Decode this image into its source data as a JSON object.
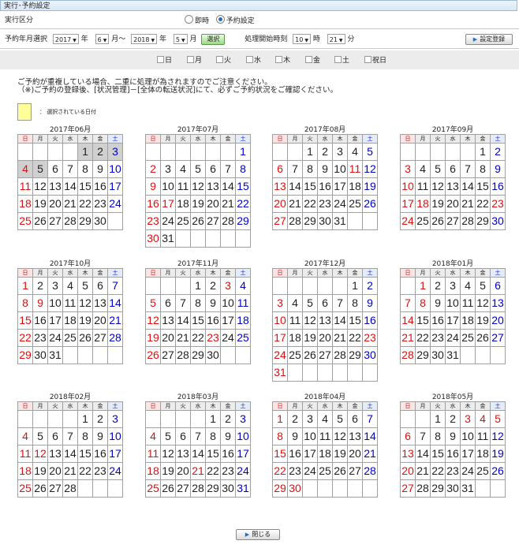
{
  "header": {
    "title": "実行･予約設定"
  },
  "exec": {
    "label": "実行区分",
    "options": [
      {
        "label": "即時",
        "selected": false
      },
      {
        "label": "予約設定",
        "selected": true
      }
    ]
  },
  "schedule": {
    "label": "予約年月選択",
    "from_year": "2017",
    "year_label1": "年",
    "from_month": "6",
    "month_label1": "月～",
    "to_year": "2018",
    "year_label2": "年",
    "to_month": "5",
    "month_label2": "月",
    "select_button": "選択",
    "time_label": "処理開始時刻",
    "hour": "10",
    "hour_label": "時",
    "minute": "21",
    "minute_label": "分",
    "settings_button": "設定登録"
  },
  "weekdays_filter": [
    "日",
    "月",
    "火",
    "水",
    "木",
    "金",
    "土",
    "祝日"
  ],
  "notice": {
    "line1": "ご予約が重複している場合、二重に処理が為されますのでご注意ください。",
    "line2": "（※)ご予約の登録後、[状況管理]－[全体の転送状況]にて、必ずご予約状況をご確認ください。"
  },
  "legend": {
    "text": "：  選択されている日付",
    "color": "#ffff99"
  },
  "weekday_headers": [
    "日",
    "月",
    "火",
    "水",
    "木",
    "金",
    "土"
  ],
  "calendars": [
    {
      "title": "2017年06月",
      "first_dow": 4,
      "days": 30,
      "red": [],
      "gray": [
        1,
        2,
        3,
        4,
        5
      ]
    },
    {
      "title": "2017年07月",
      "first_dow": 6,
      "days": 31,
      "red": [
        17
      ],
      "gray": []
    },
    {
      "title": "2017年08月",
      "first_dow": 2,
      "days": 31,
      "red": [
        11
      ],
      "gray": []
    },
    {
      "title": "2017年09月",
      "first_dow": 5,
      "days": 30,
      "red": [
        18,
        23
      ],
      "gray": []
    },
    {
      "title": "2017年10月",
      "first_dow": 0,
      "days": 31,
      "red": [
        9
      ],
      "gray": []
    },
    {
      "title": "2017年11月",
      "first_dow": 3,
      "days": 30,
      "red": [
        3,
        23
      ],
      "gray": []
    },
    {
      "title": "2017年12月",
      "first_dow": 5,
      "days": 31,
      "red": [
        23
      ],
      "gray": []
    },
    {
      "title": "2018年01月",
      "first_dow": 1,
      "days": 31,
      "red": [
        1,
        8
      ],
      "gray": []
    },
    {
      "title": "2018年02月",
      "first_dow": 4,
      "days": 28,
      "red": [
        11,
        12
      ],
      "gray": []
    },
    {
      "title": "2018年03月",
      "first_dow": 4,
      "days": 31,
      "red": [
        21
      ],
      "gray": []
    },
    {
      "title": "2018年04月",
      "first_dow": 0,
      "days": 30,
      "red": [
        29,
        30
      ],
      "gray": []
    },
    {
      "title": "2018年05月",
      "first_dow": 2,
      "days": 31,
      "red": [
        3,
        4,
        5
      ],
      "gray": []
    }
  ],
  "footer": {
    "close_button": "閉じる"
  }
}
